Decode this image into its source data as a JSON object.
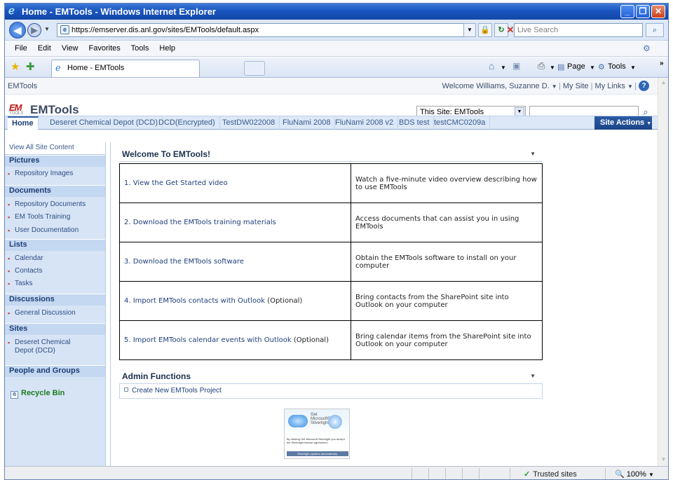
{
  "window": {
    "title": "Home - EMTools - Windows Internet Explorer",
    "minimize": "_",
    "maximize": "❐",
    "close": "✕"
  },
  "address_bar": {
    "url": "https://emserver.dis.anl.gov/sites/EMTools/default.aspx",
    "search_placeholder": "Live Search"
  },
  "menu": [
    "File",
    "Edit",
    "View",
    "Favorites",
    "Tools",
    "Help"
  ],
  "tab": {
    "label": "Home - EMTools"
  },
  "command_bar": {
    "page": "Page",
    "tools": "Tools"
  },
  "sharepoint": {
    "global": {
      "site_link": "EMTools",
      "welcome": "Welcome Williams, Suzanne D.",
      "my_site": "My Site",
      "my_links": "My Links"
    },
    "site_title": "EMTools",
    "logo_em": "EM",
    "logo_tools": "TOOLS",
    "search_scope": "This Site: EMTools",
    "top_nav": [
      "Home",
      "Deseret Chemical Depot (DCD)",
      "DCD(Encrypted)",
      "TestDW022008",
      "FluNami 2008",
      "FluNami 2008 v2",
      "BDS test",
      "testCMC0209a"
    ],
    "site_actions": "Site Actions",
    "left_nav": {
      "view_all": "View All Site Content",
      "pictures": "Pictures",
      "pictures_items": [
        "Repository Images"
      ],
      "documents": "Documents",
      "documents_items": [
        "Repository Documents",
        "EM Tools Training",
        "User Documentation"
      ],
      "lists": "Lists",
      "lists_items": [
        "Calendar",
        "Contacts",
        "Tasks"
      ],
      "discussions": "Discussions",
      "discussions_items": [
        "General Discussion"
      ],
      "sites": "Sites",
      "sites_items": [
        "Deseret Chemical Depot (DCD)"
      ],
      "people": "People and Groups",
      "recycle": "Recycle Bin"
    },
    "welcome_part": {
      "title": "Welcome To EMTools!",
      "rows": [
        {
          "link": "1. View the Get Started video",
          "opt": "",
          "desc": "Watch a five-minute video overview describing how to use EMTools"
        },
        {
          "link": "2. Download the EMTools training materials",
          "opt": "",
          "desc": "Access documents that can assist you in using EMTools"
        },
        {
          "link": "3. Download the EMTools software",
          "opt": "",
          "desc": "Obtain the EMTools software to install on your computer"
        },
        {
          "link": "4. Import EMTools contacts with Outlook",
          "opt": "(Optional)",
          "desc": "Bring contacts from the SharePoint site into Outlook on your computer"
        },
        {
          "link": "5. Import EMTools calendar events with Outlook",
          "opt": "(Optional)",
          "desc": "Bring calendar items from the SharePoint site into Outlook on your computer"
        }
      ]
    },
    "admin_part": {
      "title": "Admin Functions",
      "item": "Create New EMTools Project"
    },
    "silverlight": {
      "line1": "Get",
      "line2": "Microsoft®",
      "line3": "Silverlight™",
      "fine": "By clicking Get Microsoft Silverlight you accept the Silverlight license agreement.",
      "bar": "Silverlight updates automatically."
    }
  },
  "status_bar": {
    "zone": "Trusted sites",
    "zoom": "100%"
  }
}
